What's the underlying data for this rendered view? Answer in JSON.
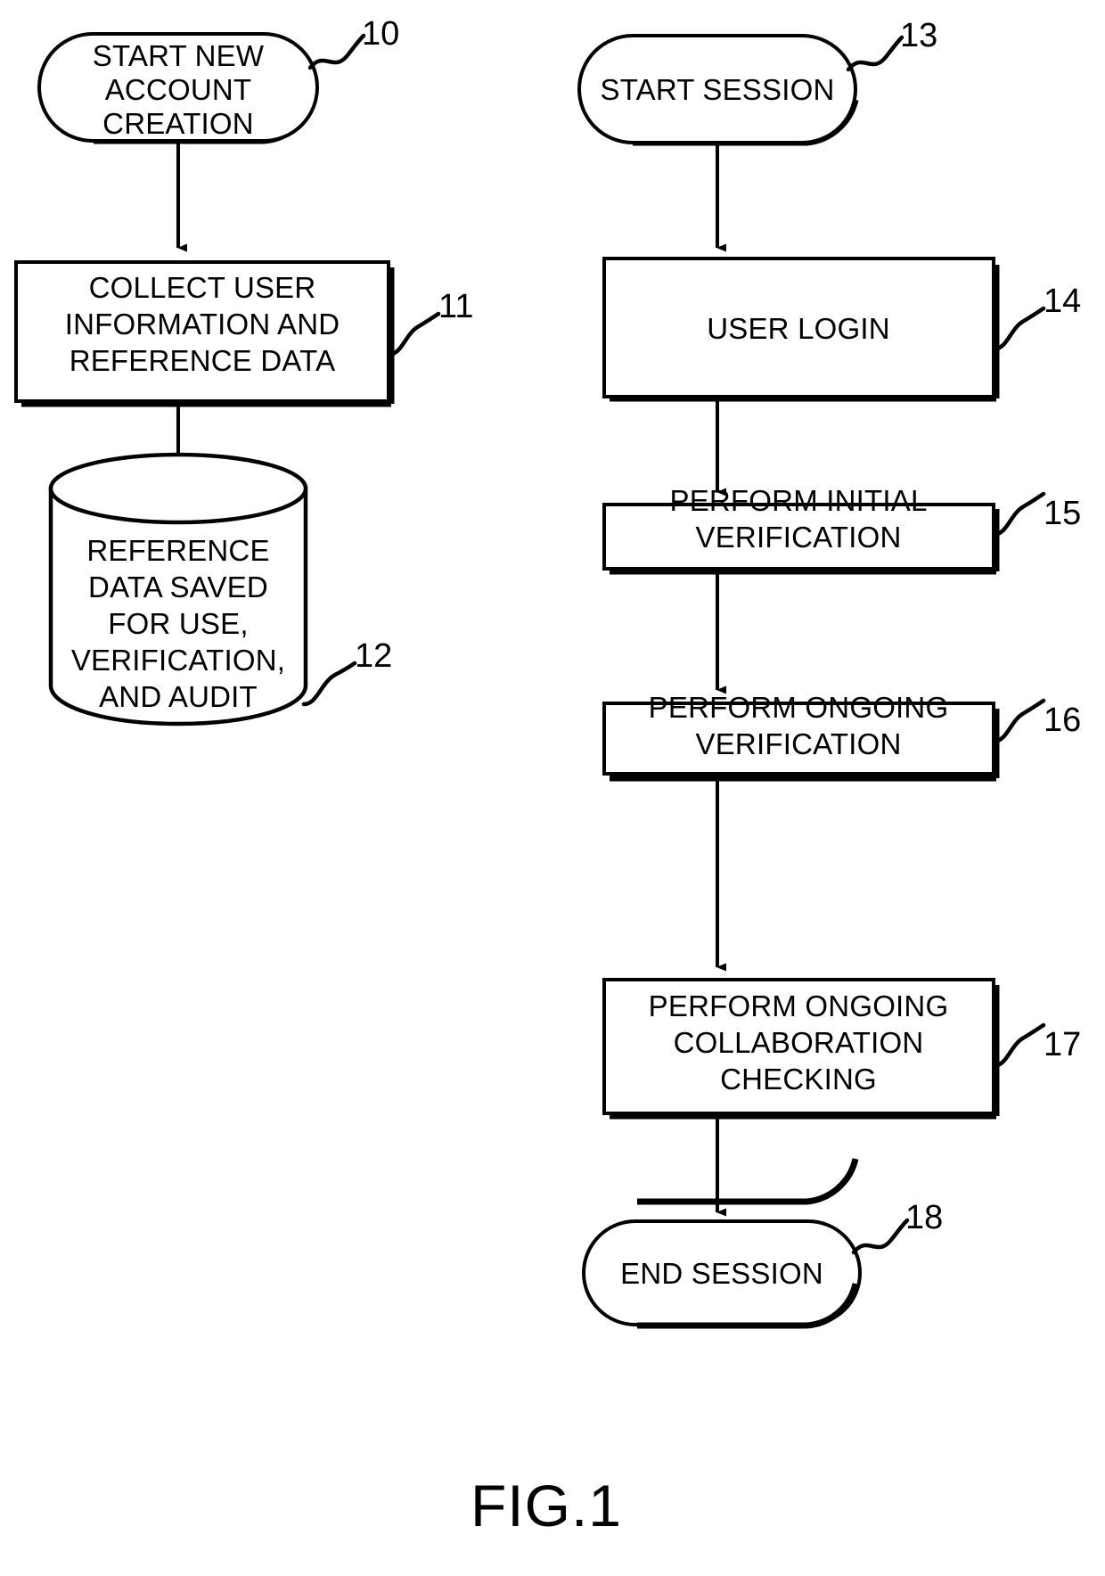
{
  "figure": {
    "caption": "FIG.1",
    "background_color": "#ffffff",
    "ink_color": "#000000"
  },
  "flows": [
    {
      "id": "account-creation-flow",
      "nodes": [
        {
          "id": "start-new-account-creation",
          "shape": "stadium",
          "ref": "10",
          "lines": [
            "START NEW",
            "ACCOUNT",
            "CREATION"
          ]
        },
        {
          "id": "collect-user-information",
          "shape": "process",
          "ref": "11",
          "lines": [
            "COLLECT USER",
            "INFORMATION AND",
            "REFERENCE DATA"
          ]
        },
        {
          "id": "reference-data-saved",
          "shape": "database",
          "ref": "12",
          "lines": [
            "REFERENCE",
            "DATA SAVED",
            "FOR USE,",
            "VERIFICATION,",
            "AND AUDIT"
          ]
        }
      ]
    },
    {
      "id": "session-flow",
      "nodes": [
        {
          "id": "start-session",
          "shape": "stadium",
          "ref": "13",
          "lines": [
            "START SESSION"
          ]
        },
        {
          "id": "user-login",
          "shape": "process",
          "ref": "14",
          "lines": [
            "USER LOGIN"
          ]
        },
        {
          "id": "perform-initial-verification",
          "shape": "process",
          "ref": "15",
          "lines": [
            "PERFORM INITIAL",
            "VERIFICATION"
          ]
        },
        {
          "id": "perform-ongoing-verification",
          "shape": "process",
          "ref": "16",
          "lines": [
            "PERFORM ONGOING",
            "VERIFICATION"
          ]
        },
        {
          "id": "perform-ongoing-collaboration-checking",
          "shape": "process",
          "ref": "17",
          "lines": [
            "PERFORM ONGOING",
            "COLLABORATION",
            "CHECKING"
          ]
        },
        {
          "id": "end-session",
          "shape": "stadium",
          "ref": "18",
          "lines": [
            "END SESSION"
          ]
        }
      ]
    }
  ],
  "labels": {
    "n10_l1": "START NEW",
    "n10_l2": "ACCOUNT",
    "n10_l3": "CREATION",
    "n10_ref": "10",
    "n11_l1": "COLLECT USER",
    "n11_l2": "INFORMATION AND",
    "n11_l3": "REFERENCE DATA",
    "n11_ref": "11",
    "n12_l1": "REFERENCE",
    "n12_l2": "DATA SAVED",
    "n12_l3": "FOR USE,",
    "n12_l4": "VERIFICATION,",
    "n12_l5": "AND AUDIT",
    "n12_ref": "12",
    "n13_l1": "START SESSION",
    "n13_ref": "13",
    "n14_l1": "USER LOGIN",
    "n14_ref": "14",
    "n15_l1": "PERFORM INITIAL",
    "n15_l2": "VERIFICATION",
    "n15_ref": "15",
    "n16_l1": "PERFORM ONGOING",
    "n16_l2": "VERIFICATION",
    "n16_ref": "16",
    "n17_l1": "PERFORM ONGOING",
    "n17_l2": "COLLABORATION",
    "n17_l3": "CHECKING",
    "n17_ref": "17",
    "n18_l1": "END SESSION",
    "n18_ref": "18",
    "caption": "FIG.1"
  }
}
